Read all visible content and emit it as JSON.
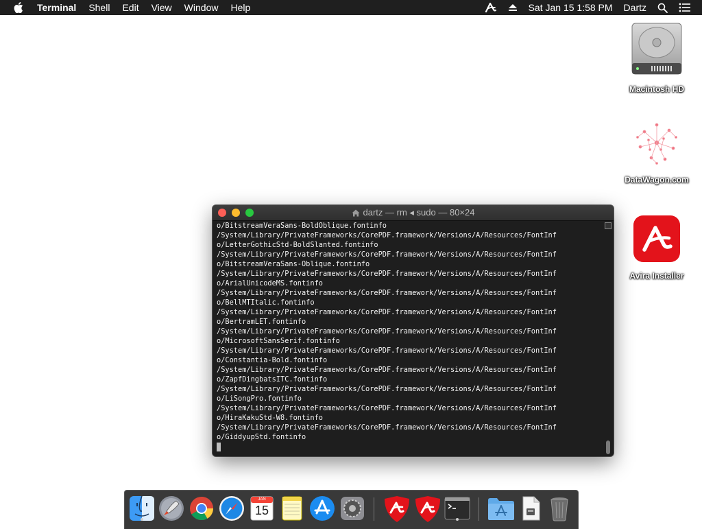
{
  "menubar": {
    "app_name": "Terminal",
    "menus": [
      "Shell",
      "Edit",
      "View",
      "Window",
      "Help"
    ],
    "clock": "Sat Jan 15  1:58 PM",
    "user": "Dartz",
    "icons": [
      "apple-icon",
      "avira-status-icon",
      "eject-icon",
      "spotlight-search-icon",
      "notification-center-icon"
    ]
  },
  "desktop": {
    "icons": [
      {
        "label": "Macintosh HD",
        "icon": "hard-drive-icon"
      },
      {
        "label": "DataWagon.com",
        "icon": "datawagon-icon"
      },
      {
        "label": "Avira Installer",
        "icon": "avira-icon",
        "color": "#e3131b"
      }
    ]
  },
  "terminal": {
    "title": "dartz — rm ◂ sudo — 80×24",
    "lines": [
      "o/BitstreamVeraSans-BoldOblique.fontinfo",
      "/System/Library/PrivateFrameworks/CorePDF.framework/Versions/A/Resources/FontInf",
      "o/LetterGothicStd-BoldSlanted.fontinfo",
      "/System/Library/PrivateFrameworks/CorePDF.framework/Versions/A/Resources/FontInf",
      "o/BitstreamVeraSans-Oblique.fontinfo",
      "/System/Library/PrivateFrameworks/CorePDF.framework/Versions/A/Resources/FontInf",
      "o/ArialUnicodeMS.fontinfo",
      "/System/Library/PrivateFrameworks/CorePDF.framework/Versions/A/Resources/FontInf",
      "o/BellMTItalic.fontinfo",
      "/System/Library/PrivateFrameworks/CorePDF.framework/Versions/A/Resources/FontInf",
      "o/BertramLET.fontinfo",
      "/System/Library/PrivateFrameworks/CorePDF.framework/Versions/A/Resources/FontInf",
      "o/MicrosoftSansSerif.fontinfo",
      "/System/Library/PrivateFrameworks/CorePDF.framework/Versions/A/Resources/FontInf",
      "o/Constantia-Bold.fontinfo",
      "/System/Library/PrivateFrameworks/CorePDF.framework/Versions/A/Resources/FontInf",
      "o/ZapfDingbatsITC.fontinfo",
      "/System/Library/PrivateFrameworks/CorePDF.framework/Versions/A/Resources/FontInf",
      "o/LiSongPro.fontinfo",
      "/System/Library/PrivateFrameworks/CorePDF.framework/Versions/A/Resources/FontInf",
      "o/HiraKakuStd-W8.fontinfo",
      "/System/Library/PrivateFrameworks/CorePDF.framework/Versions/A/Resources/FontInf",
      "o/GiddyupStd.fontinfo"
    ],
    "colors": {
      "background": "#1e1e1e",
      "text": "#f2f2f2",
      "close": "#fd5f57",
      "minimize": "#febc2e",
      "zoom": "#28c840"
    }
  },
  "dock": {
    "items": [
      {
        "icon": "finder-icon",
        "running": true
      },
      {
        "icon": "launchpad-icon",
        "running": false
      },
      {
        "icon": "chrome-icon",
        "running": false
      },
      {
        "icon": "safari-icon",
        "running": false
      },
      {
        "icon": "calendar-icon",
        "running": false,
        "month": "JAN",
        "day": "15"
      },
      {
        "icon": "notes-icon",
        "running": false
      },
      {
        "icon": "app-store-icon",
        "running": false
      },
      {
        "icon": "system-preferences-icon",
        "running": false
      },
      {
        "icon": "avira-shield-icon",
        "running": false
      },
      {
        "icon": "avira-shield-icon",
        "running": false
      },
      {
        "icon": "terminal-icon",
        "running": true
      },
      {
        "icon": "applications-folder-icon",
        "running": false
      },
      {
        "icon": "document-icon",
        "running": false
      },
      {
        "icon": "trash-icon",
        "running": false
      }
    ]
  }
}
